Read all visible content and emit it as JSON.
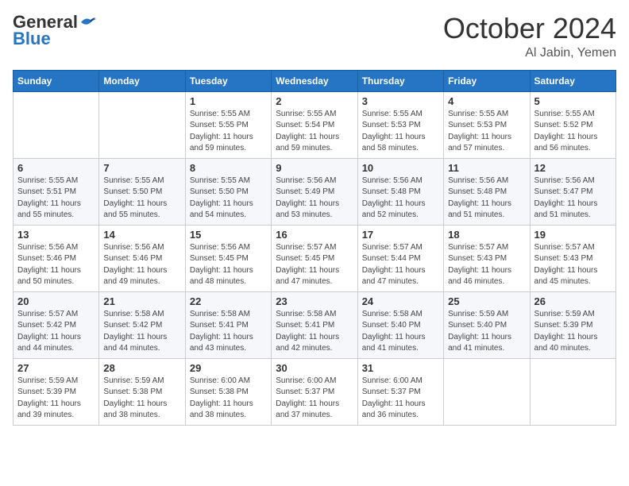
{
  "header": {
    "logo_line1": "General",
    "logo_line2": "Blue",
    "month": "October 2024",
    "location": "Al Jabin, Yemen"
  },
  "weekdays": [
    "Sunday",
    "Monday",
    "Tuesday",
    "Wednesday",
    "Thursday",
    "Friday",
    "Saturday"
  ],
  "weeks": [
    [
      {
        "day": "",
        "info": ""
      },
      {
        "day": "",
        "info": ""
      },
      {
        "day": "1",
        "info": "Sunrise: 5:55 AM\nSunset: 5:55 PM\nDaylight: 11 hours and 59 minutes."
      },
      {
        "day": "2",
        "info": "Sunrise: 5:55 AM\nSunset: 5:54 PM\nDaylight: 11 hours and 59 minutes."
      },
      {
        "day": "3",
        "info": "Sunrise: 5:55 AM\nSunset: 5:53 PM\nDaylight: 11 hours and 58 minutes."
      },
      {
        "day": "4",
        "info": "Sunrise: 5:55 AM\nSunset: 5:53 PM\nDaylight: 11 hours and 57 minutes."
      },
      {
        "day": "5",
        "info": "Sunrise: 5:55 AM\nSunset: 5:52 PM\nDaylight: 11 hours and 56 minutes."
      }
    ],
    [
      {
        "day": "6",
        "info": "Sunrise: 5:55 AM\nSunset: 5:51 PM\nDaylight: 11 hours and 55 minutes."
      },
      {
        "day": "7",
        "info": "Sunrise: 5:55 AM\nSunset: 5:50 PM\nDaylight: 11 hours and 55 minutes."
      },
      {
        "day": "8",
        "info": "Sunrise: 5:55 AM\nSunset: 5:50 PM\nDaylight: 11 hours and 54 minutes."
      },
      {
        "day": "9",
        "info": "Sunrise: 5:56 AM\nSunset: 5:49 PM\nDaylight: 11 hours and 53 minutes."
      },
      {
        "day": "10",
        "info": "Sunrise: 5:56 AM\nSunset: 5:48 PM\nDaylight: 11 hours and 52 minutes."
      },
      {
        "day": "11",
        "info": "Sunrise: 5:56 AM\nSunset: 5:48 PM\nDaylight: 11 hours and 51 minutes."
      },
      {
        "day": "12",
        "info": "Sunrise: 5:56 AM\nSunset: 5:47 PM\nDaylight: 11 hours and 51 minutes."
      }
    ],
    [
      {
        "day": "13",
        "info": "Sunrise: 5:56 AM\nSunset: 5:46 PM\nDaylight: 11 hours and 50 minutes."
      },
      {
        "day": "14",
        "info": "Sunrise: 5:56 AM\nSunset: 5:46 PM\nDaylight: 11 hours and 49 minutes."
      },
      {
        "day": "15",
        "info": "Sunrise: 5:56 AM\nSunset: 5:45 PM\nDaylight: 11 hours and 48 minutes."
      },
      {
        "day": "16",
        "info": "Sunrise: 5:57 AM\nSunset: 5:45 PM\nDaylight: 11 hours and 47 minutes."
      },
      {
        "day": "17",
        "info": "Sunrise: 5:57 AM\nSunset: 5:44 PM\nDaylight: 11 hours and 47 minutes."
      },
      {
        "day": "18",
        "info": "Sunrise: 5:57 AM\nSunset: 5:43 PM\nDaylight: 11 hours and 46 minutes."
      },
      {
        "day": "19",
        "info": "Sunrise: 5:57 AM\nSunset: 5:43 PM\nDaylight: 11 hours and 45 minutes."
      }
    ],
    [
      {
        "day": "20",
        "info": "Sunrise: 5:57 AM\nSunset: 5:42 PM\nDaylight: 11 hours and 44 minutes."
      },
      {
        "day": "21",
        "info": "Sunrise: 5:58 AM\nSunset: 5:42 PM\nDaylight: 11 hours and 44 minutes."
      },
      {
        "day": "22",
        "info": "Sunrise: 5:58 AM\nSunset: 5:41 PM\nDaylight: 11 hours and 43 minutes."
      },
      {
        "day": "23",
        "info": "Sunrise: 5:58 AM\nSunset: 5:41 PM\nDaylight: 11 hours and 42 minutes."
      },
      {
        "day": "24",
        "info": "Sunrise: 5:58 AM\nSunset: 5:40 PM\nDaylight: 11 hours and 41 minutes."
      },
      {
        "day": "25",
        "info": "Sunrise: 5:59 AM\nSunset: 5:40 PM\nDaylight: 11 hours and 41 minutes."
      },
      {
        "day": "26",
        "info": "Sunrise: 5:59 AM\nSunset: 5:39 PM\nDaylight: 11 hours and 40 minutes."
      }
    ],
    [
      {
        "day": "27",
        "info": "Sunrise: 5:59 AM\nSunset: 5:39 PM\nDaylight: 11 hours and 39 minutes."
      },
      {
        "day": "28",
        "info": "Sunrise: 5:59 AM\nSunset: 5:38 PM\nDaylight: 11 hours and 38 minutes."
      },
      {
        "day": "29",
        "info": "Sunrise: 6:00 AM\nSunset: 5:38 PM\nDaylight: 11 hours and 38 minutes."
      },
      {
        "day": "30",
        "info": "Sunrise: 6:00 AM\nSunset: 5:37 PM\nDaylight: 11 hours and 37 minutes."
      },
      {
        "day": "31",
        "info": "Sunrise: 6:00 AM\nSunset: 5:37 PM\nDaylight: 11 hours and 36 minutes."
      },
      {
        "day": "",
        "info": ""
      },
      {
        "day": "",
        "info": ""
      }
    ]
  ]
}
